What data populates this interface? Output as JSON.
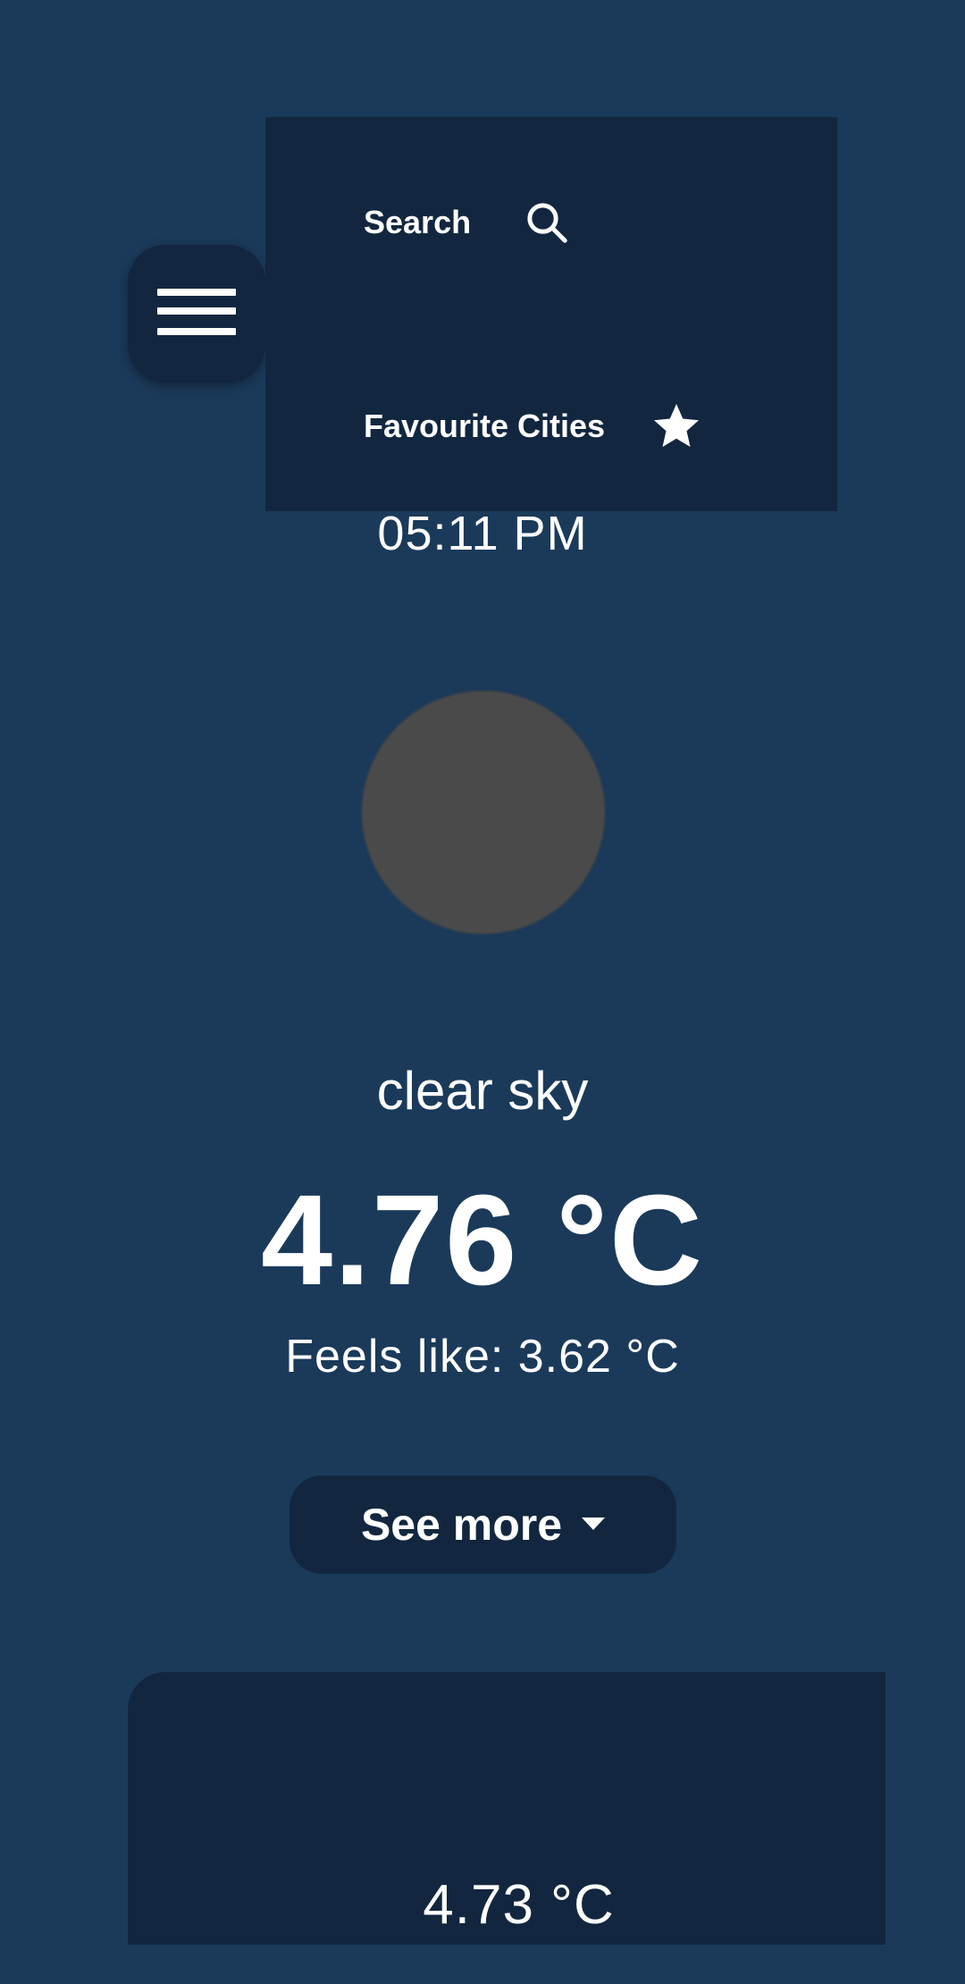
{
  "menu": {
    "items": [
      {
        "label": "Search",
        "icon": "search-icon"
      },
      {
        "label": "Favourite Cities",
        "icon": "star-icon"
      }
    ]
  },
  "weather": {
    "time": "05:11 PM",
    "description": "clear sky",
    "temperature": "4.76 °C",
    "feels_like": "Feels like: 3.62 °C",
    "see_more_label": "See more"
  },
  "forecast": {
    "temperature": "4.73 °C"
  },
  "colors": {
    "background": "#1b3a5a",
    "surface": "#12263f",
    "icon_placeholder": "#4a4a4a",
    "text": "#ffffff"
  }
}
